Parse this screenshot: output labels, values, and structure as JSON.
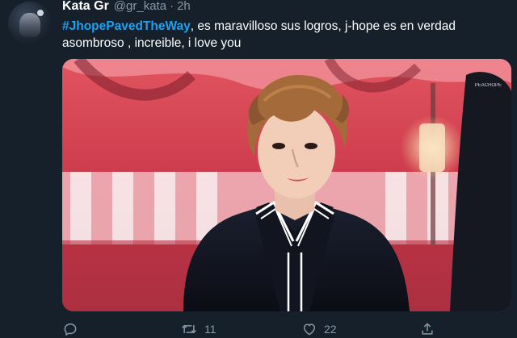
{
  "tweet": {
    "author_name": "Kata Gr",
    "handle": "@gr_kata",
    "separator": "·",
    "time": "2h",
    "hashtag": "#JhopePavedTheWay",
    "text": ", es maravilloso sus logros, j-hope es en verdad asombroso , increible, i love you",
    "media_watermark": "PEACHOPE"
  },
  "actions": {
    "reply_icon": "reply-icon",
    "retweet_icon": "retweet-icon",
    "retweet_count": "11",
    "like_icon": "heart-icon",
    "like_count": "22",
    "share_icon": "share-icon"
  },
  "colors": {
    "background": "#15202b",
    "text": "#ffffff",
    "secondary": "#8899a6",
    "hashtag": "#1da1f2"
  }
}
